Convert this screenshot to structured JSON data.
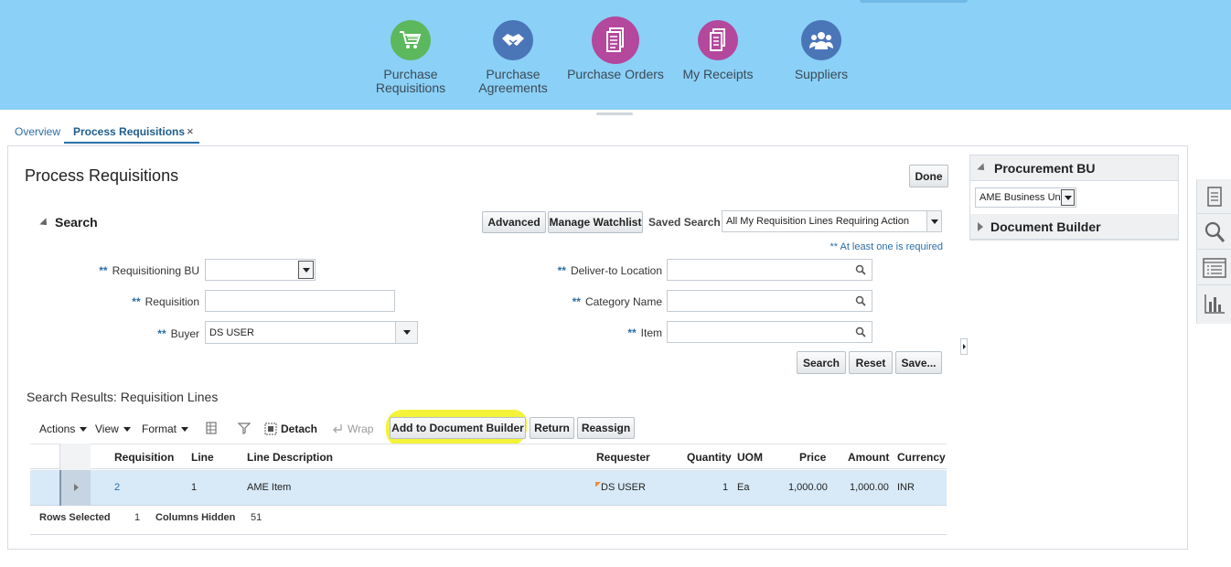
{
  "nav": [
    {
      "label": "Purchase Requisitions",
      "line1": "Purchase",
      "line2": "Requisitions",
      "icon": "shopping-cart-icon",
      "color": "#5cb85c"
    },
    {
      "label": "Purchase Agreements",
      "line1": "Purchase",
      "line2": "Agreements",
      "icon": "handshake-icon",
      "color": "#4a76b8"
    },
    {
      "label": "Purchase Orders",
      "line1": "Purchase Orders",
      "line2": "",
      "icon": "document-icon",
      "color": "#b4489c"
    },
    {
      "label": "My Receipts",
      "line1": "My Receipts",
      "line2": "",
      "icon": "receipt-icon",
      "color": "#b4489c"
    },
    {
      "label": "Suppliers",
      "line1": "Suppliers",
      "line2": "",
      "icon": "people-icon",
      "color": "#4a76b8"
    }
  ],
  "tabs": {
    "overview": "Overview",
    "active": "Process Requisitions",
    "close": "×"
  },
  "page": {
    "title": "Process Requisitions",
    "done": "Done"
  },
  "search": {
    "heading": "Search",
    "advanced": "Advanced",
    "manage_watchlist": "Manage Watchlist",
    "saved_search_label": "Saved Search",
    "saved_search_value": "All My Requisition Lines Requiring Action",
    "required_hint": "** At least one is required",
    "required_mark": "**",
    "fields": {
      "requisitioning_bu": {
        "label": "Requisitioning BU",
        "value": ""
      },
      "requisition": {
        "label": "Requisition",
        "value": ""
      },
      "buyer": {
        "label": "Buyer",
        "value": "DS USER"
      },
      "deliver_to_location": {
        "label": "Deliver-to Location",
        "value": ""
      },
      "category_name": {
        "label": "Category Name",
        "value": ""
      },
      "item": {
        "label": "Item",
        "value": ""
      }
    },
    "buttons": {
      "search": "Search",
      "reset": "Reset",
      "save": "Save..."
    }
  },
  "results": {
    "title": "Search Results: Requisition Lines",
    "toolbar": {
      "actions": "Actions",
      "view": "View",
      "format": "Format",
      "detach": "Detach",
      "wrap": "Wrap",
      "add_to_document_builder": "Add to Document Builder",
      "return": "Return",
      "reassign": "Reassign"
    },
    "columns": [
      "Requisition",
      "Line",
      "Line Description",
      "Requester",
      "Quantity",
      "UOM",
      "Price",
      "Amount",
      "Currency"
    ],
    "rows": [
      {
        "requisition": "2",
        "line": "1",
        "line_description": "AME Item",
        "requester": "DS USER",
        "quantity": "1",
        "uom": "Ea",
        "price": "1,000.00",
        "amount": "1,000.00",
        "currency": "INR"
      }
    ],
    "footer": {
      "rows_selected_label": "Rows Selected",
      "rows_selected": "1",
      "columns_hidden_label": "Columns Hidden",
      "columns_hidden": "51"
    }
  },
  "right_panel": {
    "procurement_bu_title": "Procurement BU",
    "procurement_bu_value": "AME Business Unit",
    "document_builder_title": "Document Builder"
  },
  "rail": [
    "worklist-icon",
    "search-icon",
    "list-icon",
    "chart-icon"
  ],
  "colors": {
    "banner": "#8bd0f7",
    "link": "#2a6ea6",
    "highlight": "#f4f33a",
    "selected_row": "#d8eaf7"
  }
}
